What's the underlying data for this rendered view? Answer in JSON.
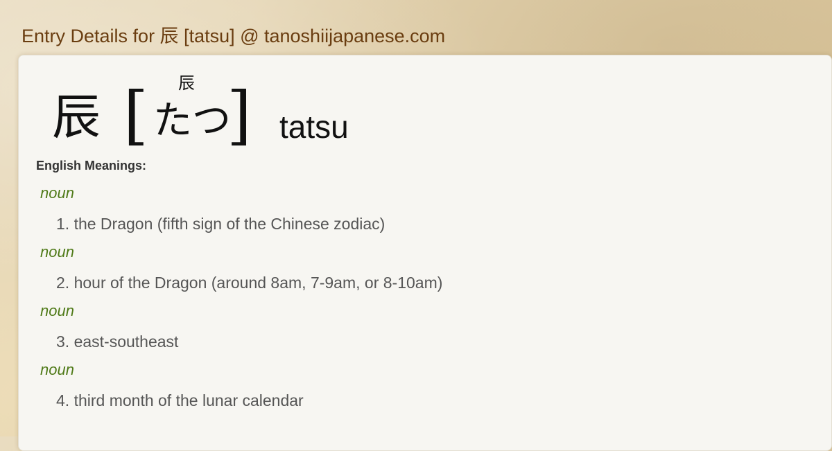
{
  "page": {
    "title": "Entry Details for 辰 [tatsu] @ tanoshiijapanese.com"
  },
  "entry": {
    "kanji": "辰",
    "bracket_open": "[",
    "bracket_close": "]",
    "furigana": "辰",
    "kana": "たつ",
    "romaji": "tatsu"
  },
  "meanings": {
    "label": "English Meanings:",
    "items": [
      {
        "pos": "noun",
        "definition": "1. the Dragon (fifth sign of the Chinese zodiac)"
      },
      {
        "pos": "noun",
        "definition": "2. hour of the Dragon (around 8am, 7-9am, or 8-10am)"
      },
      {
        "pos": "noun",
        "definition": "3. east-southeast"
      },
      {
        "pos": "noun",
        "definition": "4. third month of the lunar calendar"
      }
    ]
  },
  "colors": {
    "title": "#6a3d10",
    "pos": "#4f7a18",
    "definition": "#555555",
    "card_background": "#f7f6f2"
  }
}
